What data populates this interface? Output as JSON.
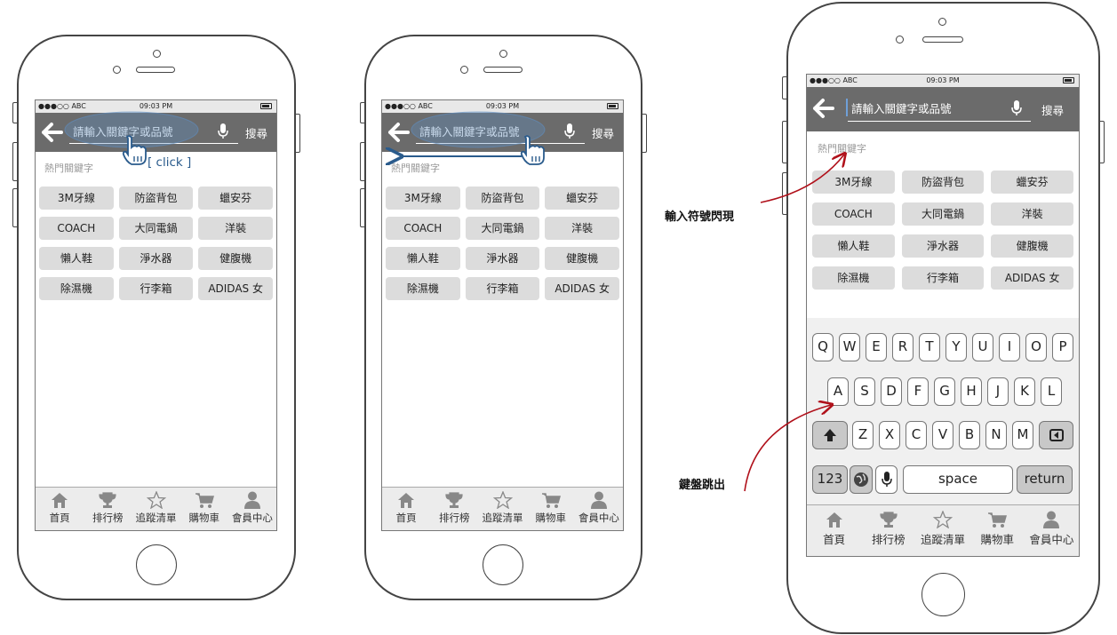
{
  "status": {
    "carrier": "●●●○○ ABC",
    "time": "09:03 PM"
  },
  "search": {
    "placeholder": "請輸入關鍵字或品號",
    "button_label": "搜尋"
  },
  "hot_label": "熱門關鍵字",
  "keywords": [
    "3M牙線",
    "防盜背包",
    "蠟安芬",
    "COACH",
    "大同電鍋",
    "洋裝",
    "懶人鞋",
    "淨水器",
    "健腹機",
    "除濕機",
    "行李箱",
    "ADIDAS 女"
  ],
  "tabs": [
    {
      "label": "首頁",
      "icon": "home-icon"
    },
    {
      "label": "排行榜",
      "icon": "trophy-icon"
    },
    {
      "label": "追蹤清單",
      "icon": "star-icon"
    },
    {
      "label": "購物車",
      "icon": "cart-icon"
    },
    {
      "label": "會員中心",
      "icon": "user-icon"
    }
  ],
  "keyboard": {
    "row1": [
      "Q",
      "W",
      "E",
      "R",
      "T",
      "Y",
      "U",
      "I",
      "O",
      "P"
    ],
    "row2": [
      "A",
      "S",
      "D",
      "F",
      "G",
      "H",
      "J",
      "K",
      "L"
    ],
    "row3": [
      "Z",
      "X",
      "C",
      "V",
      "B",
      "N",
      "M"
    ],
    "numbers_label": "123",
    "space_label": "space",
    "return_label": "return"
  },
  "annotations": {
    "click": "[ click ]",
    "cursor_blink": "輸入符號閃現",
    "keyboard_popup": "鍵盤跳出"
  },
  "colors": {
    "search_bar": "#6b6b6b",
    "arrow_red": "#b0101a",
    "highlight_blue": "#2a5b8c"
  }
}
